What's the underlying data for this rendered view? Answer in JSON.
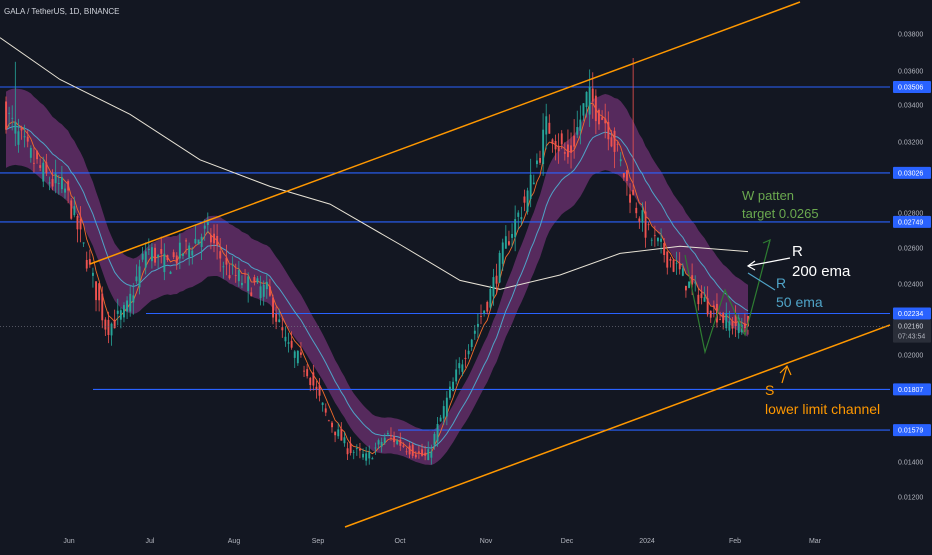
{
  "header": {
    "symbol_line": "GALA / TetherUS, 1D, BINANCE"
  },
  "colors": {
    "background": "#131722",
    "candle_up": "#26a69a",
    "candle_down": "#ef5350",
    "horizontal_level": "#2962ff",
    "channel": "#ff9800",
    "ema_band": "#8e3b8e",
    "ema_50": "#4fa3c7",
    "ema_200": "#e8e3d6",
    "fast_ema": "#f06b2a",
    "w_pattern": "#2e7d32",
    "annotation_green": "#6aa84f",
    "annotation_white": "#ffffff",
    "annotation_blue": "#4fa3c7",
    "annotation_orange": "#ff9800"
  },
  "chart_data": {
    "type": "candlestick",
    "title": "GALA / TetherUS, 1D, BINANCE",
    "y_axis": {
      "ticks": [
        "0.03800",
        "0.03600",
        "0.03400",
        "0.03200",
        "0.02800",
        "0.02600",
        "0.02400",
        "0.02000",
        "0.01400",
        "0.01200"
      ],
      "tick_values": [
        0.038,
        0.036,
        0.034,
        0.032,
        0.028,
        0.026,
        0.024,
        0.02,
        0.014,
        0.012
      ],
      "position": "right"
    },
    "x_axis": {
      "labels": [
        "Jun",
        "Jul",
        "Aug",
        "Sep",
        "Oct",
        "Nov",
        "Dec",
        "2024",
        "Feb",
        "Mar"
      ]
    },
    "price_levels": [
      {
        "label": "0.03506",
        "value": 0.03506,
        "start_month": "May"
      },
      {
        "label": "0.03026",
        "value": 0.03026,
        "start_month": "May"
      },
      {
        "label": "0.02749",
        "value": 0.02749,
        "start_month": "May"
      },
      {
        "label": "0.02234",
        "value": 0.02234,
        "start_month": "Jul"
      },
      {
        "label": "0.01807",
        "value": 0.01807,
        "start_month": "Jun"
      },
      {
        "label": "0.01579",
        "value": 0.01579,
        "start_month": "Oct"
      }
    ],
    "last_price": {
      "label": "0.02160",
      "value": 0.0216,
      "countdown": "07:43:54"
    },
    "closes_sampled": [
      0.0335,
      0.0315,
      0.03,
      0.0292,
      0.0255,
      0.0215,
      0.0225,
      0.026,
      0.025,
      0.026,
      0.027,
      0.0248,
      0.024,
      0.0236,
      0.0205,
      0.0192,
      0.0165,
      0.0148,
      0.0142,
      0.0155,
      0.0148,
      0.0142,
      0.0175,
      0.0205,
      0.023,
      0.0265,
      0.029,
      0.033,
      0.031,
      0.0345,
      0.033,
      0.0295,
      0.0268,
      0.0255,
      0.024,
      0.0228,
      0.0218,
      0.0216
    ],
    "series": [
      {
        "name": "200 ema"
      },
      {
        "name": "50 ema"
      }
    ],
    "annotations": [
      {
        "text": "W patten",
        "color": "green"
      },
      {
        "text": "target 0.0265",
        "color": "green"
      },
      {
        "text": "R",
        "color": "white"
      },
      {
        "text": "200 ema",
        "color": "white"
      },
      {
        "text": "R",
        "color": "blue"
      },
      {
        "text": "50 ema",
        "color": "blue"
      },
      {
        "text": "S",
        "color": "orange"
      },
      {
        "text": "lower limit channel",
        "color": "orange"
      }
    ],
    "grid": false,
    "legend": "none"
  }
}
